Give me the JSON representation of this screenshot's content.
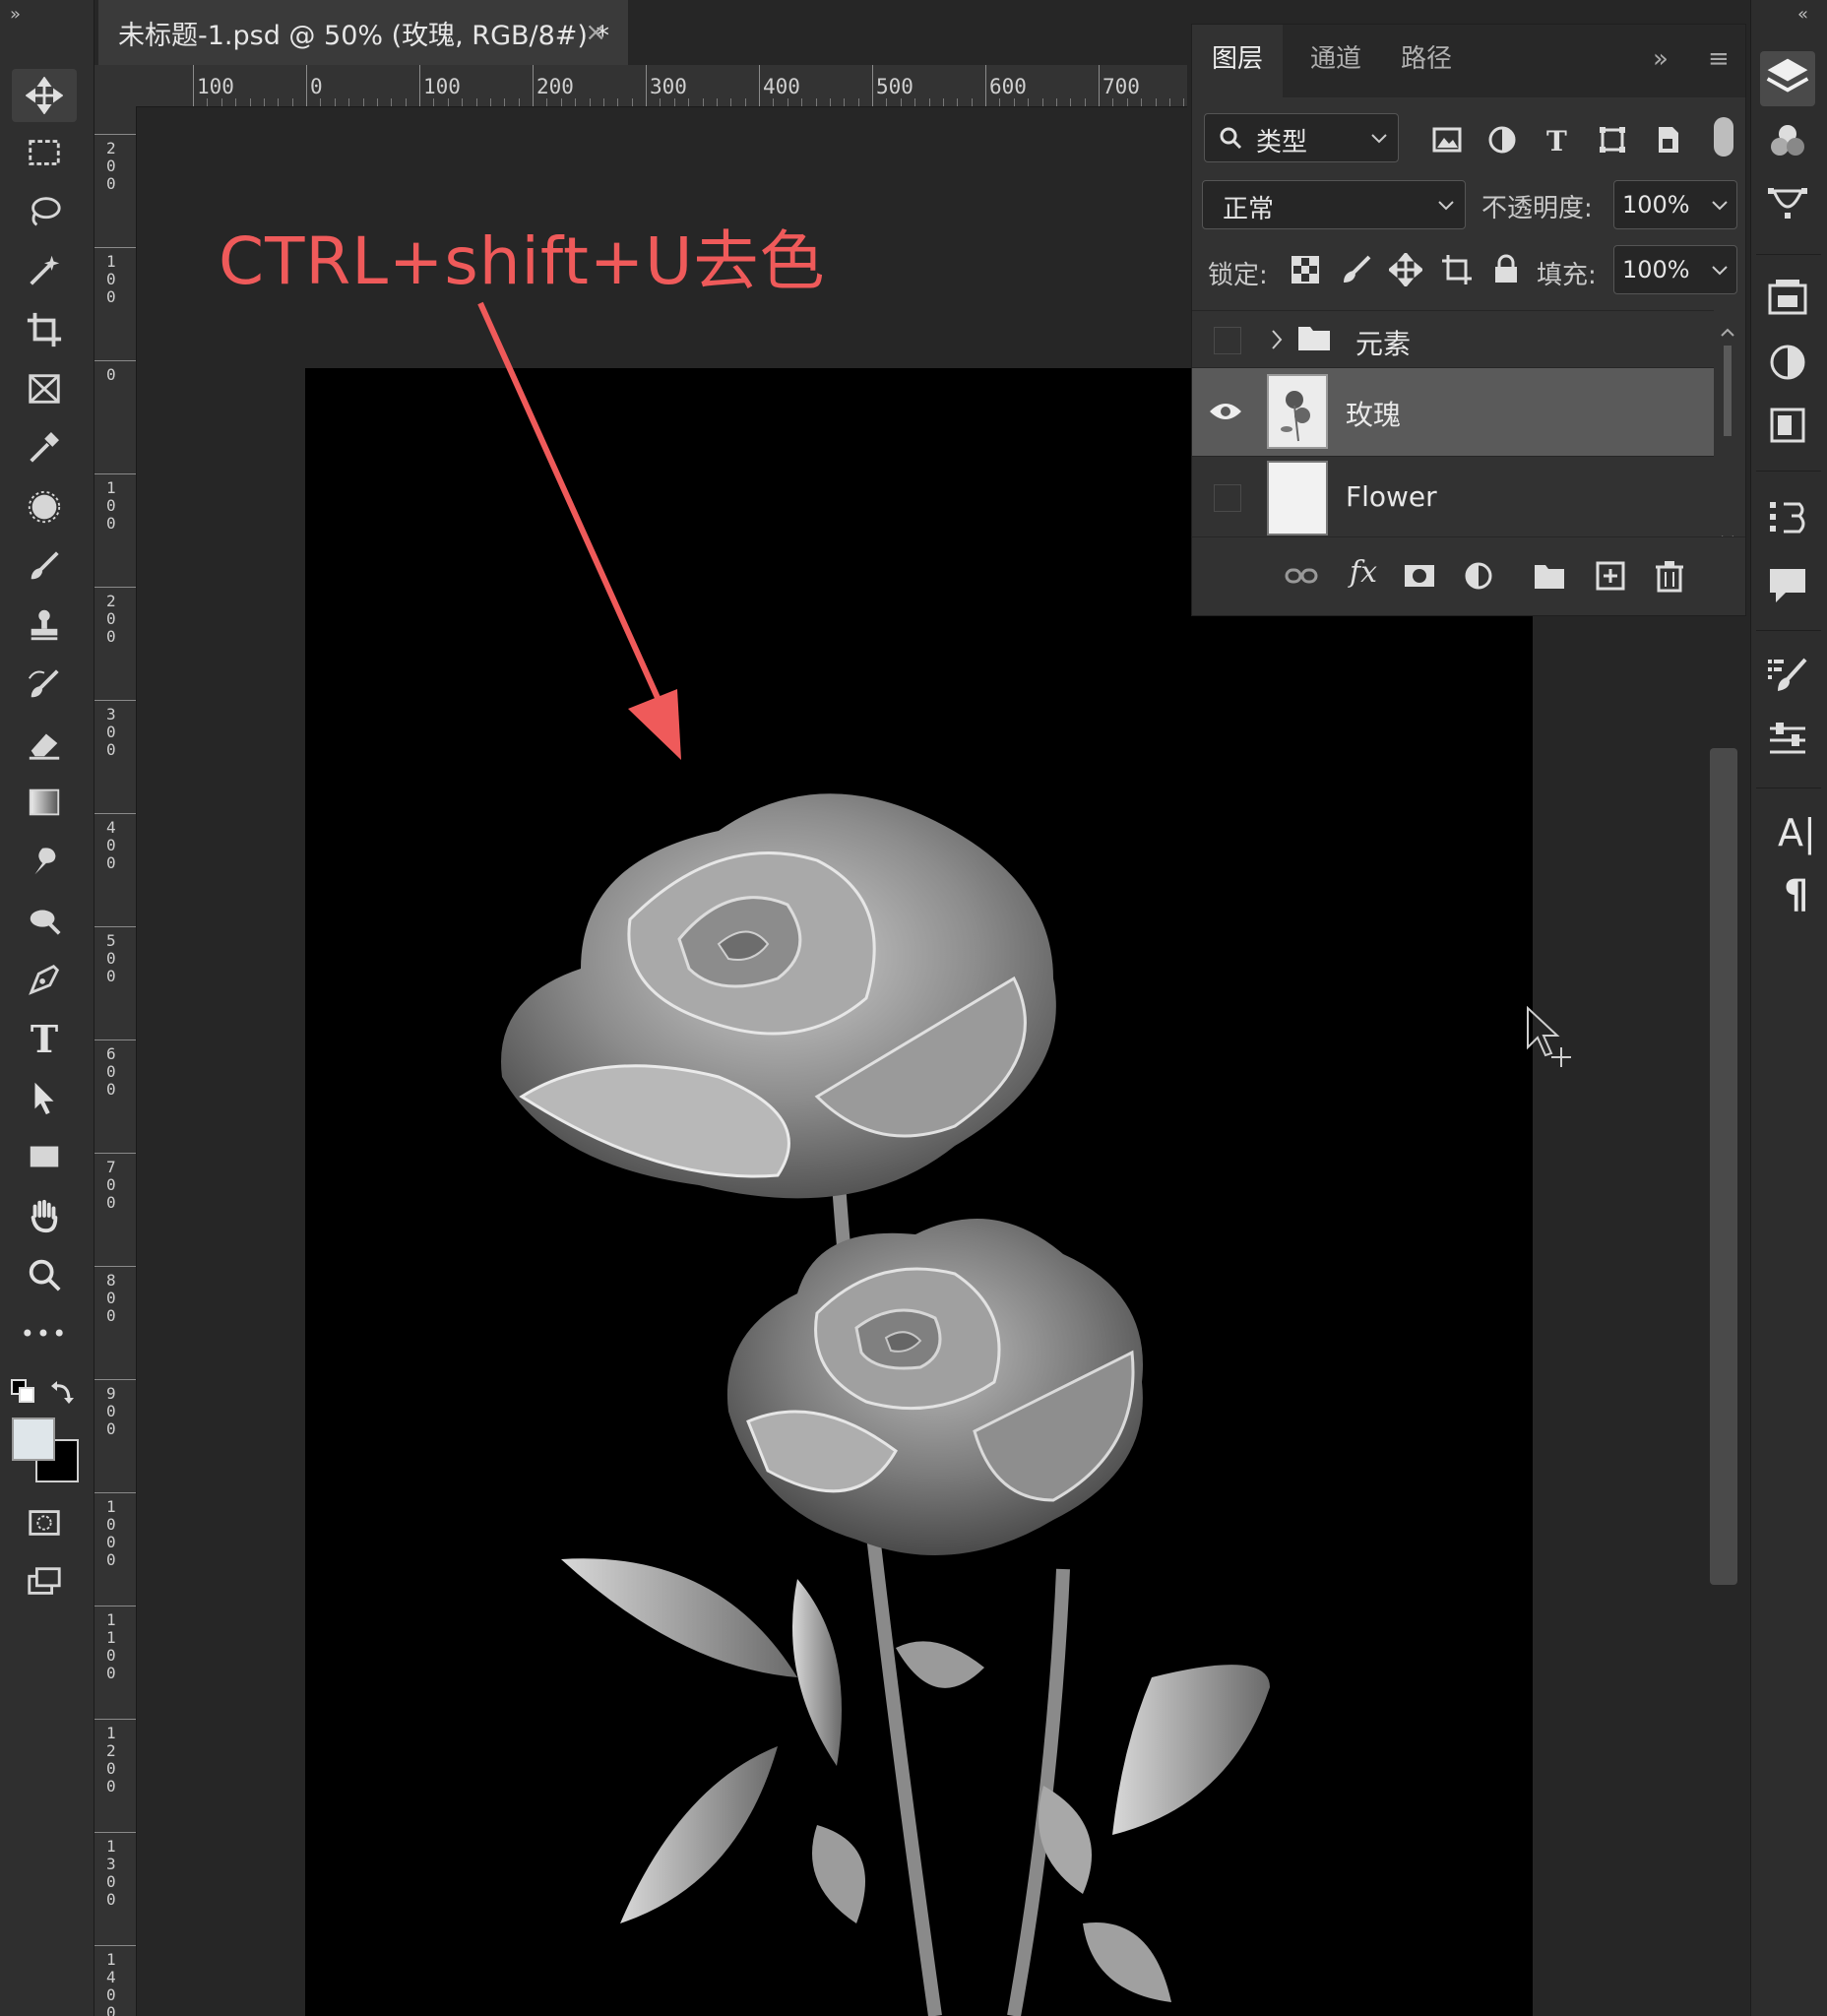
{
  "document_tab": {
    "title": "未标题-1.psd @ 50% (玫瑰, RGB/8#) *",
    "close": "×"
  },
  "panel_toggles": {
    "left": "»",
    "right": "«"
  },
  "rulers": {
    "top": [
      "100",
      "0",
      "100",
      "200",
      "300",
      "400",
      "500",
      "600",
      "700"
    ],
    "left": [
      "200",
      "100",
      "0",
      "100",
      "200",
      "300",
      "400",
      "500",
      "600",
      "700",
      "800",
      "900",
      "1000",
      "1100",
      "1200",
      "1300",
      "1400"
    ]
  },
  "annotation": {
    "text": "CTRL+shift+U去色",
    "color": "#ef5a5a"
  },
  "toolbar": {
    "tools": [
      "move-tool",
      "marquee-tool",
      "lasso-tool",
      "magic-wand-tool",
      "crop-tool",
      "frame-tool",
      "eyedropper-tool",
      "spot-healing-tool",
      "brush-tool",
      "clone-stamp-tool",
      "history-brush-tool",
      "eraser-tool",
      "gradient-tool",
      "smudge-tool",
      "dodge-tool",
      "pen-tool",
      "type-tool",
      "path-selection-tool",
      "rectangle-tool",
      "hand-tool",
      "zoom-tool",
      "more-tools",
      "default-colors",
      "swap-colors",
      "foreground-color",
      "background-color",
      "quick-mask",
      "screen-mode"
    ],
    "type_tool_glyph": "T",
    "more_glyph": "•••"
  },
  "layers_panel": {
    "tabs": [
      "图层",
      "通道",
      "路径"
    ],
    "expand": "»",
    "menu": "≡",
    "filter": {
      "label": "类型"
    },
    "blend_mode": "正常",
    "opacity_label": "不透明度:",
    "opacity": "100%",
    "lock_label": "锁定:",
    "fill_label": "填充:",
    "fill": "100%",
    "layers": [
      {
        "name": "元素",
        "kind": "group",
        "visible": false,
        "selected": false
      },
      {
        "name": "玫瑰",
        "kind": "image",
        "visible": true,
        "selected": true
      },
      {
        "name": "Flower",
        "kind": "image",
        "visible": false,
        "selected": false
      }
    ],
    "fx_label": "fx"
  },
  "right_strip": {
    "icons": [
      "layers-icon",
      "color-icon",
      "paths-icon",
      "libraries-icon",
      "adjustments-icon",
      "properties-icon",
      "history-icon",
      "comments-icon",
      "brush-settings-icon",
      "brush-presets-icon",
      "character-icon",
      "paragraph-icon"
    ],
    "character_glyph": "A|",
    "paragraph_glyph": "¶"
  },
  "colors": {
    "foreground": "#dfe6ea",
    "background": "#000000",
    "annotation": "#ef5a5a",
    "selected_layer": "#5a5a5a"
  }
}
